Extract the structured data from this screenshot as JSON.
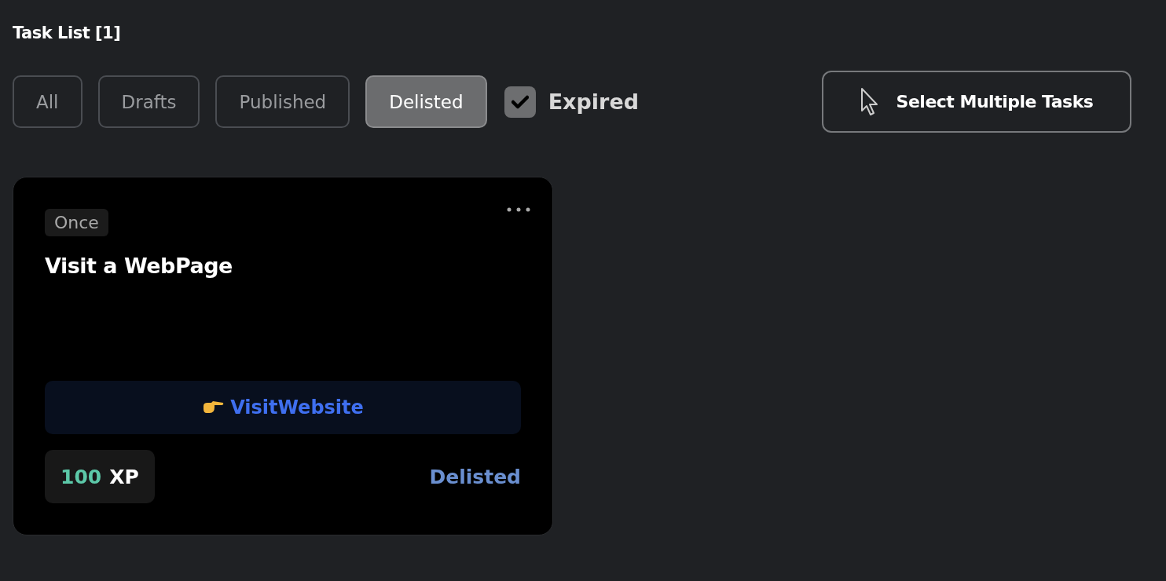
{
  "title": "Task List [1]",
  "filters": [
    {
      "label": "All",
      "selected": false
    },
    {
      "label": "Drafts",
      "selected": false
    },
    {
      "label": "Published",
      "selected": false
    },
    {
      "label": "Delisted",
      "selected": true
    }
  ],
  "expired": {
    "label": "Expired",
    "checked": true
  },
  "select_button": {
    "label": "Select Multiple Tasks"
  },
  "tasks": [
    {
      "frequency": "Once",
      "title": "Visit a WebPage",
      "action": "VisitWebsite",
      "xp_value": "100",
      "xp_unit": "XP",
      "status": "Delisted"
    }
  ]
}
